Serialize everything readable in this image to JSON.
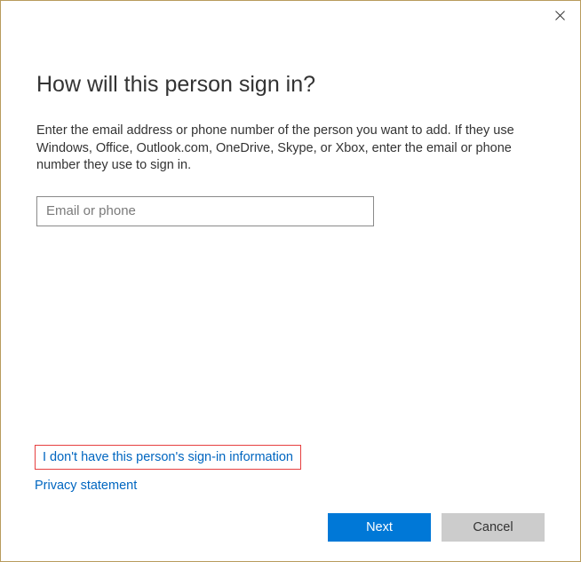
{
  "dialog": {
    "heading": "How will this person sign in?",
    "body": "Enter the email address or phone number of the person you want to add. If they use Windows, Office, Outlook.com, OneDrive, Skype, or Xbox, enter the email or phone number they use to sign in.",
    "input_placeholder": "Email or phone",
    "link_no_info": "I don't have this person's sign-in information",
    "link_privacy": "Privacy statement",
    "btn_next": "Next",
    "btn_cancel": "Cancel"
  }
}
